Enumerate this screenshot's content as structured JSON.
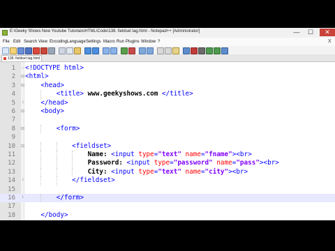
{
  "window": {
    "title": "E:\\Geeky Shows New Youtube Tutorials\\HTML\\Code\\138. fieldset tag.html - Notepad++ [Administrator]",
    "min_glyph": "—",
    "max_glyph": "☐",
    "close_glyph": "✕"
  },
  "menu": {
    "items": [
      "File",
      "Edit",
      "Search",
      "View",
      "Encoding",
      "Language",
      "Settings",
      "Macro",
      "Run",
      "Plugins",
      "Window",
      "?"
    ],
    "close_glyph": "X"
  },
  "tab": {
    "label": "138. fieldset tag.html"
  },
  "editor": {
    "current_line": 16,
    "lines": [
      {
        "n": "1",
        "indent": "",
        "parts": [
          {
            "t": "tag",
            "v": "<!DOCTYPE html>"
          }
        ]
      },
      {
        "n": "2",
        "indent": "",
        "parts": [
          {
            "t": "tag",
            "v": "<html>"
          }
        ]
      },
      {
        "n": "3",
        "indent": "    ",
        "parts": [
          {
            "t": "tag",
            "v": "<head>"
          }
        ]
      },
      {
        "n": "4",
        "indent": "        ",
        "parts": [
          {
            "t": "tag",
            "v": "<title>"
          },
          {
            "t": "txt",
            "v": " www.geekyshows.com "
          },
          {
            "t": "tag",
            "v": "</title>"
          }
        ]
      },
      {
        "n": "5",
        "indent": "    ",
        "parts": [
          {
            "t": "tag",
            "v": "</head>"
          }
        ]
      },
      {
        "n": "6",
        "indent": "    ",
        "parts": [
          {
            "t": "tag",
            "v": "<body>"
          }
        ]
      },
      {
        "n": "7",
        "indent": "",
        "parts": []
      },
      {
        "n": "8",
        "indent": "        ",
        "parts": [
          {
            "t": "tag",
            "v": "<form>"
          }
        ]
      },
      {
        "n": "9",
        "indent": "",
        "parts": []
      },
      {
        "n": "10",
        "indent": "            ",
        "parts": [
          {
            "t": "tag",
            "v": "<fieldset>"
          }
        ]
      },
      {
        "n": "11",
        "indent": "                ",
        "parts": [
          {
            "t": "txt",
            "v": "Name: "
          },
          {
            "t": "tag",
            "v": "<input "
          },
          {
            "t": "attr",
            "v": "type"
          },
          {
            "t": "tag",
            "v": "="
          },
          {
            "t": "val",
            "v": "\"text\""
          },
          {
            "t": "tag",
            "v": " "
          },
          {
            "t": "attr",
            "v": "name"
          },
          {
            "t": "tag",
            "v": "="
          },
          {
            "t": "val",
            "v": "\"fname\""
          },
          {
            "t": "tag",
            "v": "><br>"
          }
        ]
      },
      {
        "n": "12",
        "indent": "                ",
        "parts": [
          {
            "t": "txt",
            "v": "Password: "
          },
          {
            "t": "tag",
            "v": "<input "
          },
          {
            "t": "attr",
            "v": "type"
          },
          {
            "t": "tag",
            "v": "="
          },
          {
            "t": "val",
            "v": "\"password\""
          },
          {
            "t": "tag",
            "v": " "
          },
          {
            "t": "attr",
            "v": "name"
          },
          {
            "t": "tag",
            "v": "="
          },
          {
            "t": "val",
            "v": "\"pass\""
          },
          {
            "t": "tag",
            "v": "><br>"
          }
        ]
      },
      {
        "n": "13",
        "indent": "                ",
        "parts": [
          {
            "t": "txt",
            "v": "City: "
          },
          {
            "t": "tag",
            "v": "<input "
          },
          {
            "t": "attr",
            "v": "type"
          },
          {
            "t": "tag",
            "v": "="
          },
          {
            "t": "val",
            "v": "\"text\""
          },
          {
            "t": "tag",
            "v": " "
          },
          {
            "t": "attr",
            "v": "name"
          },
          {
            "t": "tag",
            "v": "="
          },
          {
            "t": "val",
            "v": "\"city\""
          },
          {
            "t": "tag",
            "v": "><br>"
          }
        ]
      },
      {
        "n": "14",
        "indent": "            ",
        "parts": [
          {
            "t": "tag",
            "v": "</fieldset>"
          }
        ]
      },
      {
        "n": "15",
        "indent": "",
        "parts": []
      },
      {
        "n": "16",
        "indent": "        ",
        "parts": [
          {
            "t": "tag",
            "v": "</form>"
          }
        ]
      },
      {
        "n": "17",
        "indent": "",
        "parts": []
      },
      {
        "n": "18",
        "indent": "    ",
        "parts": [
          {
            "t": "tag",
            "v": "</body>"
          }
        ]
      }
    ]
  }
}
